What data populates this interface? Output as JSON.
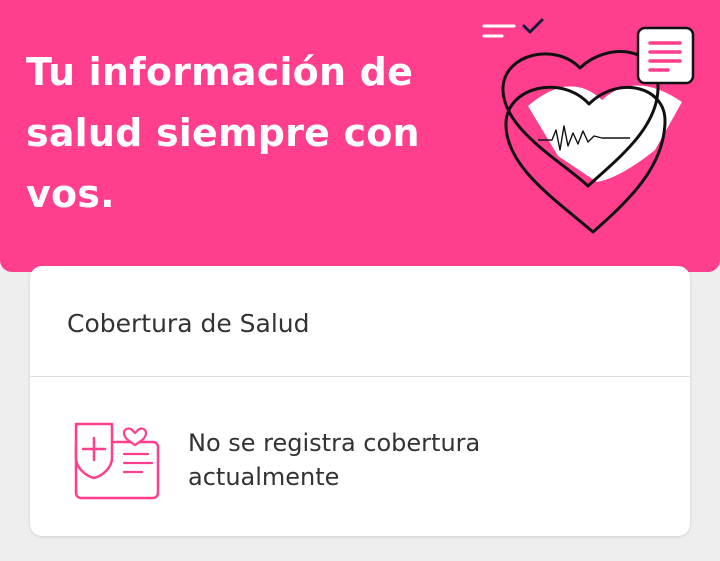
{
  "hero": {
    "title": "Tu información de salud siempre con vos.",
    "background_color": "#ff3f8e"
  },
  "illustration": {
    "name": "health-hearts-illustration",
    "icons": [
      "heart-icon",
      "heartbeat-icon",
      "checkmark-icon",
      "document-icon"
    ]
  },
  "coverage_card": {
    "title": "Cobertura de Salud",
    "status": "No se registra cobertura actualmente",
    "icon": "health-insurance-card-icon",
    "accent_color": "#ff3f8e"
  }
}
